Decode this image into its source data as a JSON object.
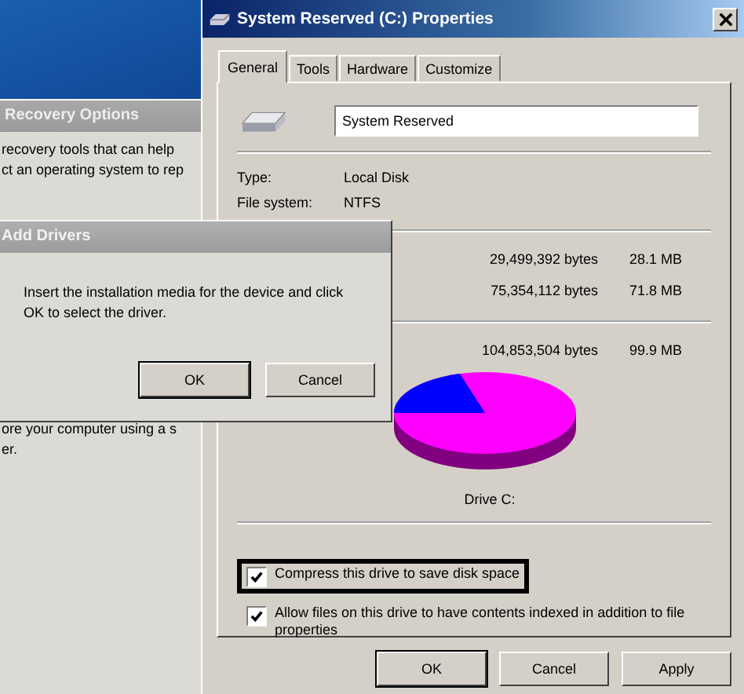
{
  "recovery_window": {
    "title": "Recovery Options",
    "lines": [
      "recovery tools that can help",
      "ct an operating system to rep",
      "ore your computer using a s",
      "er."
    ]
  },
  "properties_window": {
    "title": "System Reserved (C:) Properties",
    "tabs": [
      {
        "label": "General",
        "selected": true
      },
      {
        "label": "Tools",
        "selected": false
      },
      {
        "label": "Hardware",
        "selected": false
      },
      {
        "label": "Customize",
        "selected": false
      }
    ],
    "name_field": {
      "value": "System Reserved"
    },
    "info": [
      {
        "label": "Type:",
        "value": "Local Disk"
      },
      {
        "label": "File system:",
        "value": "NTFS"
      }
    ],
    "space": [
      {
        "bytes": "29,499,392 bytes",
        "size": "28.1 MB"
      },
      {
        "bytes": "75,354,112 bytes",
        "size": "71.8 MB"
      }
    ],
    "total": {
      "bytes": "104,853,504 bytes",
      "size": "99.9 MB"
    },
    "chart_label": "Drive C:",
    "options": [
      {
        "label": "Compress this drive to save disk space",
        "checked": true,
        "focused": true
      },
      {
        "label": "Allow files on this drive to have contents indexed in addition to file properties",
        "checked": true,
        "focused": false
      }
    ],
    "buttons": [
      {
        "label": "OK",
        "default": true
      },
      {
        "label": "Cancel",
        "default": false
      },
      {
        "label": "Apply",
        "default": false
      }
    ]
  },
  "add_drivers": {
    "title": "Add Drivers",
    "message": "Insert the installation media for the device and click OK to select the driver.",
    "buttons": [
      {
        "label": "OK",
        "default": true
      },
      {
        "label": "Cancel",
        "default": false
      }
    ]
  }
}
